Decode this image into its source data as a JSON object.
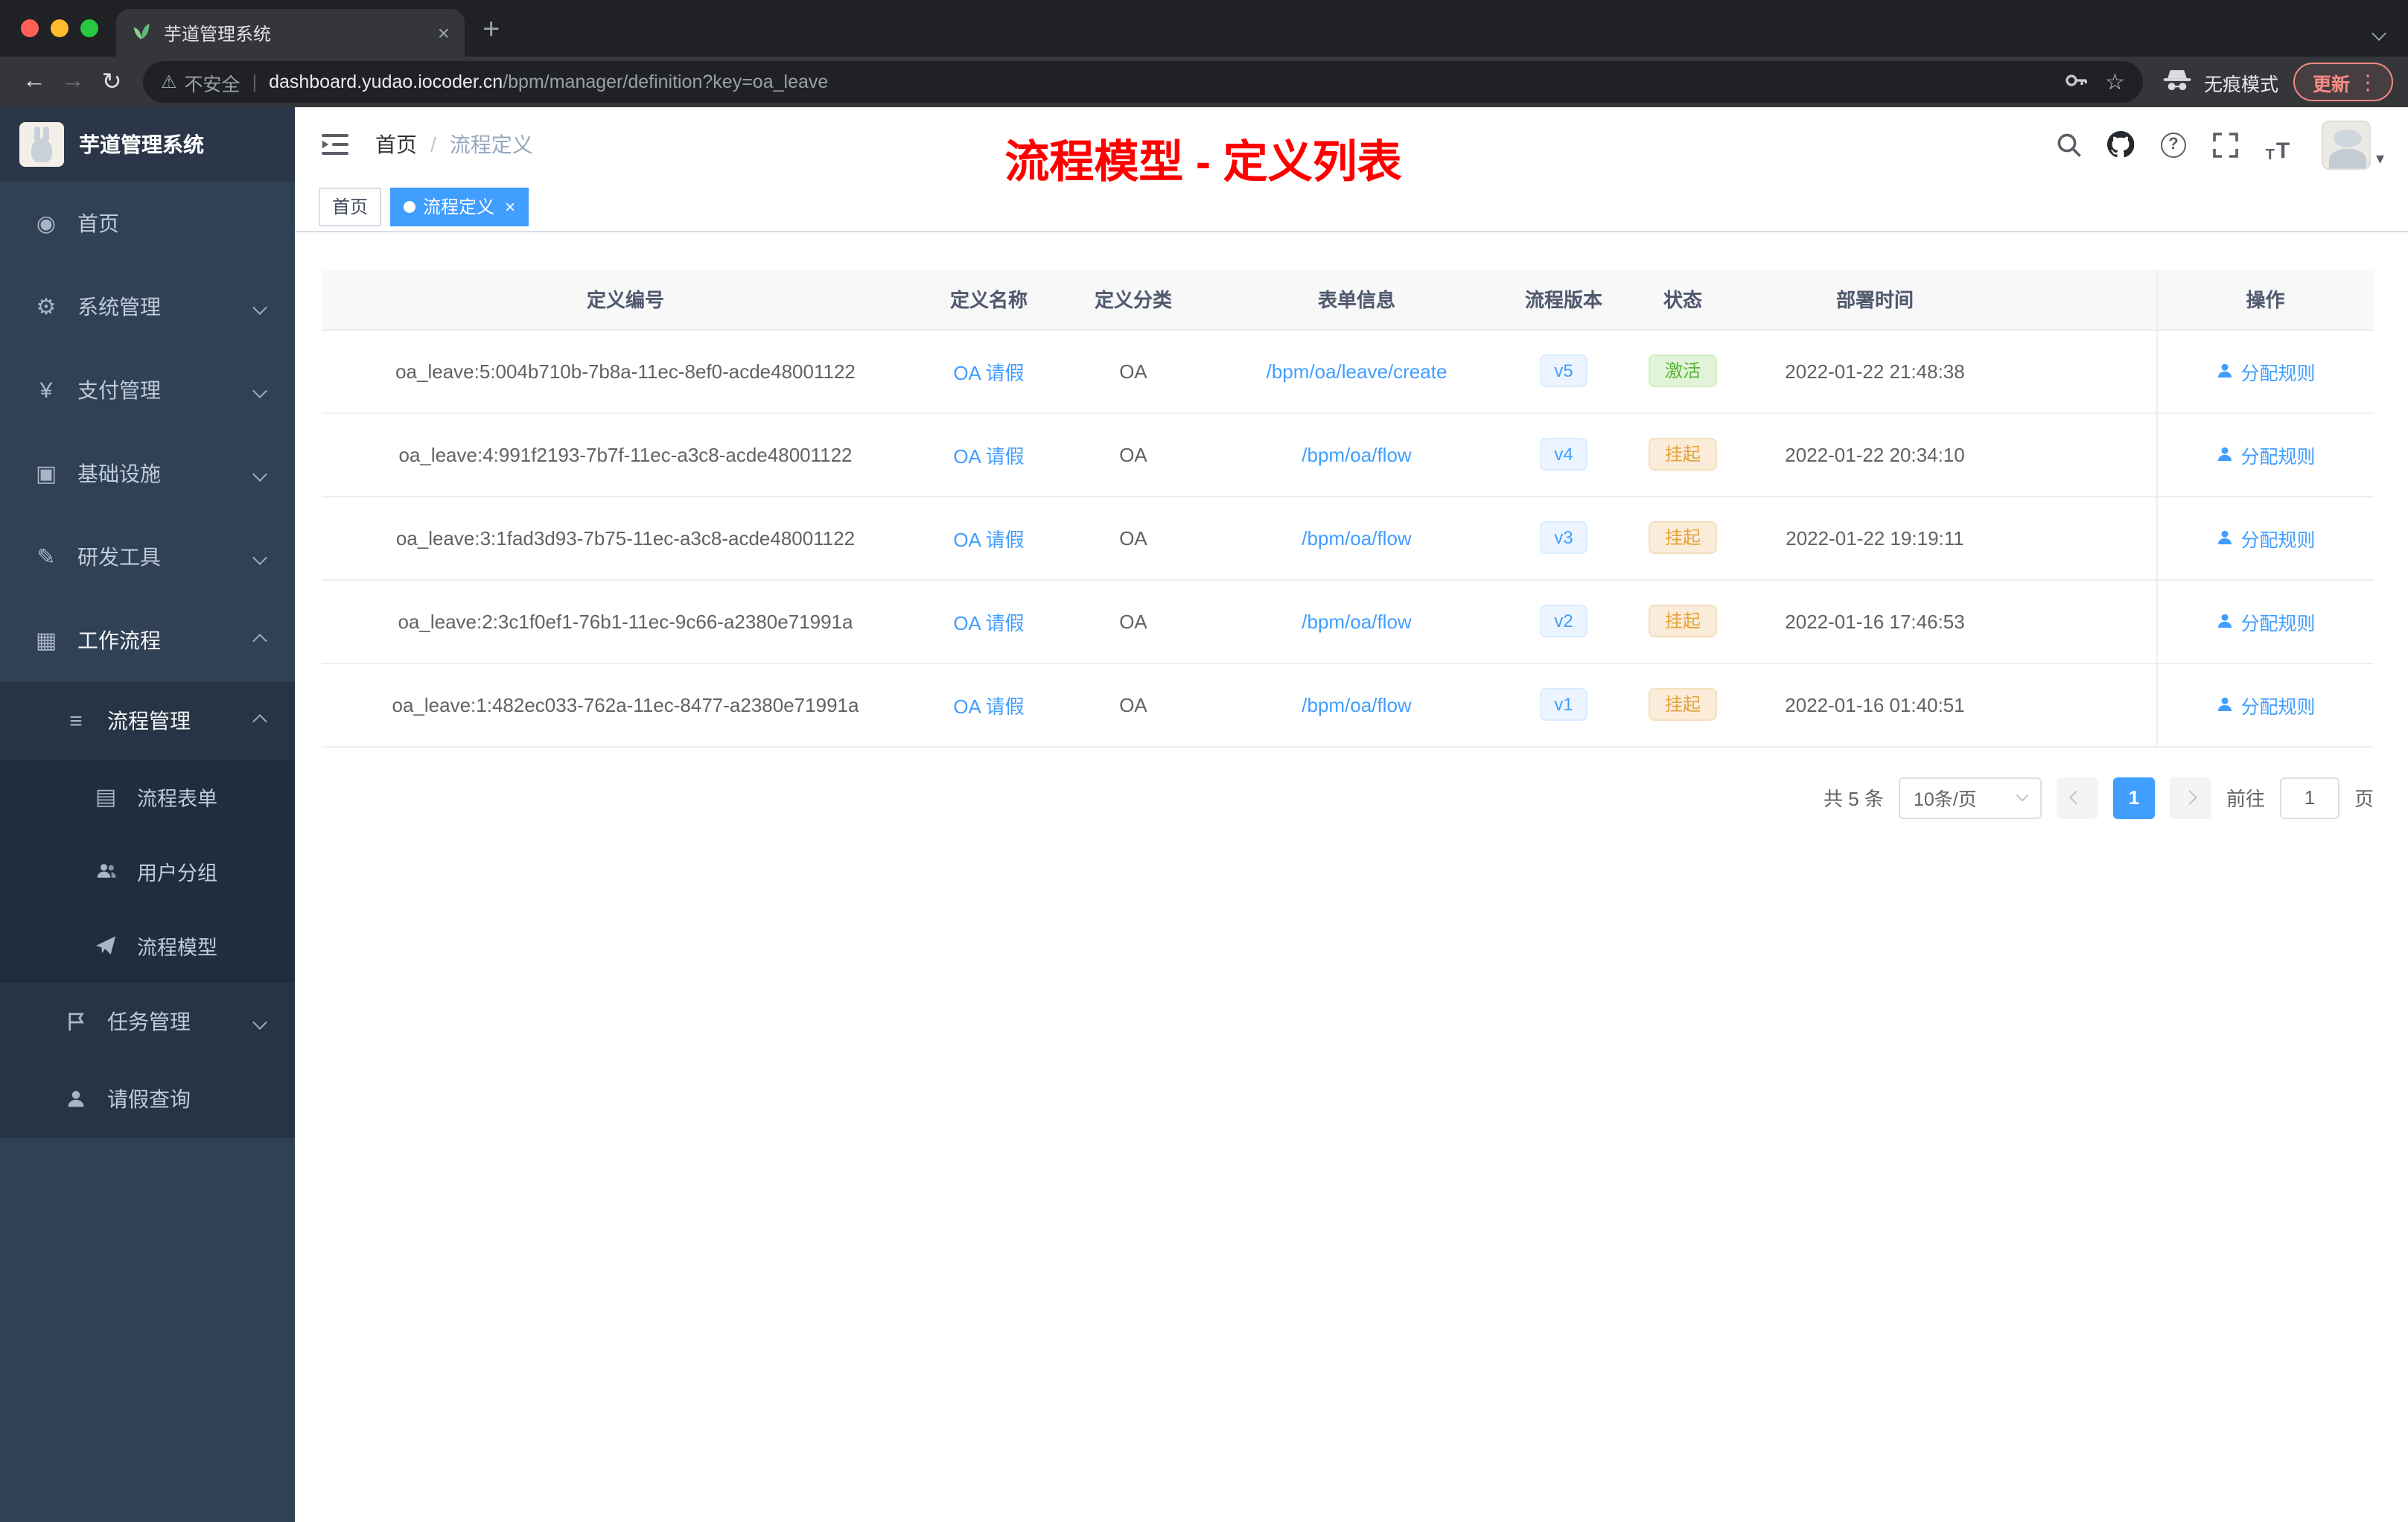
{
  "colors": {
    "primary": "#409eff",
    "annotation_red": "#ff0000",
    "success": "#67c23a",
    "warning": "#e6a23c",
    "sidebar_bg": "#304156"
  },
  "icons": {
    "back": "←",
    "forward": "→",
    "reload": "↻",
    "warning": "⚠",
    "star": "☆",
    "dots": "⋮",
    "close": "×",
    "new_tab": "+",
    "home": "◉",
    "gear": "⚙",
    "yen": "¥",
    "infra": "▣",
    "tools": "✎",
    "workflow": "▦",
    "list": "≡",
    "doc": "▤",
    "question": "?",
    "slash": "/",
    "caret": "▾"
  },
  "browser": {
    "tab_title": "芋道管理系统",
    "security": "不安全",
    "host": "dashboard.yudao.iocoder.cn",
    "path": "/bpm/manager/definition?key=oa_leave",
    "incognito": "无痕模式",
    "update": "更新"
  },
  "sidebar": {
    "brand": "芋道管理系统",
    "items": [
      {
        "label": "首页"
      },
      {
        "label": "系统管理"
      },
      {
        "label": "支付管理"
      },
      {
        "label": "基础设施"
      },
      {
        "label": "研发工具"
      },
      {
        "label": "工作流程"
      },
      {
        "label": "流程管理"
      },
      {
        "label": "流程表单"
      },
      {
        "label": "用户分组"
      },
      {
        "label": "流程模型"
      },
      {
        "label": "任务管理"
      },
      {
        "label": "请假查询"
      }
    ]
  },
  "header": {
    "breadcrumb_home": "首页",
    "breadcrumb_current": "流程定义",
    "annotation": "流程模型 - 定义列表"
  },
  "tags": {
    "home": "首页",
    "active": "流程定义"
  },
  "table": {
    "columns": [
      "定义编号",
      "定义名称",
      "定义分类",
      "表单信息",
      "流程版本",
      "状态",
      "部署时间",
      "操作"
    ],
    "rows": [
      {
        "id": "oa_leave:5:004b710b-7b8a-11ec-8ef0-acde48001122",
        "name": "OA 请假",
        "category": "OA",
        "form": "/bpm/oa/leave/create",
        "version": "v5",
        "status": "激活",
        "time": "2022-01-22 21:48:38",
        "action": "分配规则"
      },
      {
        "id": "oa_leave:4:991f2193-7b7f-11ec-a3c8-acde48001122",
        "name": "OA 请假",
        "category": "OA",
        "form": "/bpm/oa/flow",
        "version": "v4",
        "status": "挂起",
        "time": "2022-01-22 20:34:10",
        "action": "分配规则"
      },
      {
        "id": "oa_leave:3:1fad3d93-7b75-11ec-a3c8-acde48001122",
        "name": "OA 请假",
        "category": "OA",
        "form": "/bpm/oa/flow",
        "version": "v3",
        "status": "挂起",
        "time": "2022-01-22 19:19:11",
        "action": "分配规则"
      },
      {
        "id": "oa_leave:2:3c1f0ef1-76b1-11ec-9c66-a2380e71991a",
        "name": "OA 请假",
        "category": "OA",
        "form": "/bpm/oa/flow",
        "version": "v2",
        "status": "挂起",
        "time": "2022-01-16 17:46:53",
        "action": "分配规则"
      },
      {
        "id": "oa_leave:1:482ec033-762a-11ec-8477-a2380e71991a",
        "name": "OA 请假",
        "category": "OA",
        "form": "/bpm/oa/flow",
        "version": "v1",
        "status": "挂起",
        "time": "2022-01-16 01:40:51",
        "action": "分配规则"
      }
    ]
  },
  "pagination": {
    "total": "共 5 条",
    "page_size": "10条/页",
    "current": "1",
    "goto_label": "前往",
    "goto_value": "1",
    "unit": "页"
  }
}
